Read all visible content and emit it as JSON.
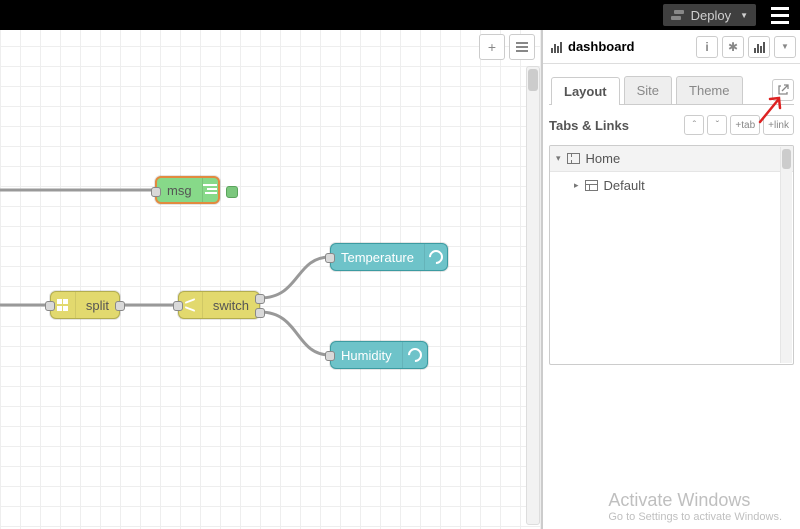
{
  "topbar": {
    "deploy_label": "Deploy"
  },
  "canvas": {
    "nodes": {
      "msg": {
        "label": "msg"
      },
      "split": {
        "label": "split"
      },
      "switch": {
        "label": "switch"
      },
      "temperature": {
        "label": "Temperature"
      },
      "humidity": {
        "label": "Humidity"
      }
    }
  },
  "sidebar": {
    "title": "dashboard",
    "tabs": {
      "layout": "Layout",
      "site": "Site",
      "theme": "Theme"
    },
    "section_header": "Tabs & Links",
    "add_tab_label": "tab",
    "add_link_label": "link",
    "tree": {
      "root": "Home",
      "child": "Default"
    }
  },
  "watermark": {
    "title": "Activate Windows",
    "subtitle": "Go to Settings to activate Windows."
  }
}
